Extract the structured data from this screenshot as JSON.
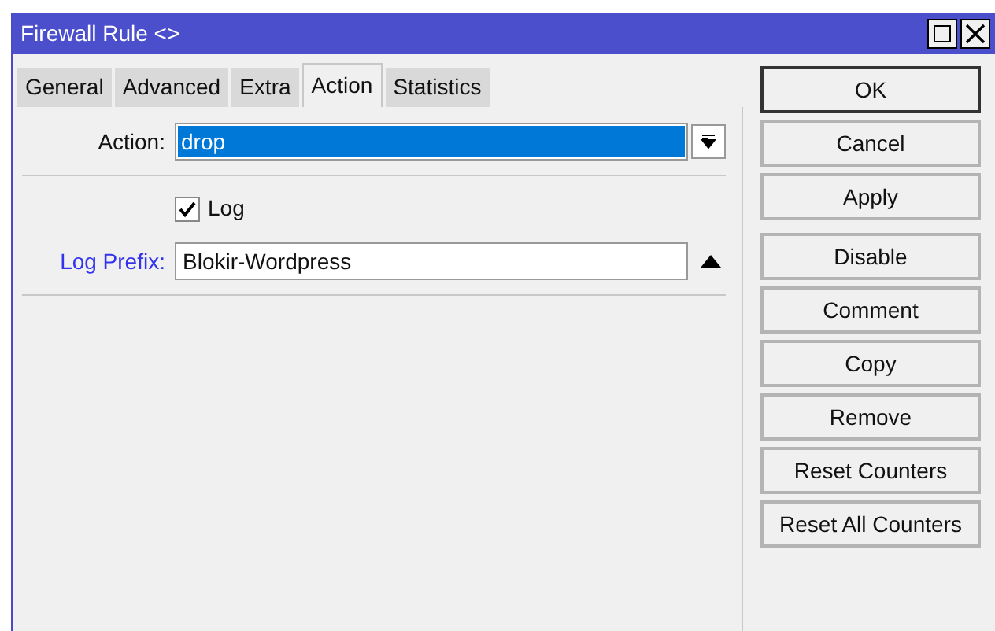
{
  "window": {
    "title": "Firewall Rule <>"
  },
  "tabs": [
    {
      "label": "General",
      "selected": false
    },
    {
      "label": "Advanced",
      "selected": false
    },
    {
      "label": "Extra",
      "selected": false
    },
    {
      "label": "Action",
      "selected": true
    },
    {
      "label": "Statistics",
      "selected": false
    }
  ],
  "action": {
    "label": "Action:",
    "value": "drop"
  },
  "log": {
    "label": "Log",
    "checked": true
  },
  "log_prefix": {
    "label": "Log Prefix:",
    "value": "Blokir-Wordpress"
  },
  "button_groups": [
    [
      {
        "label": "OK",
        "default": true
      },
      {
        "label": "Cancel",
        "default": false
      },
      {
        "label": "Apply",
        "default": false
      }
    ],
    [
      {
        "label": "Disable",
        "default": false
      },
      {
        "label": "Comment",
        "default": false
      },
      {
        "label": "Copy",
        "default": false
      },
      {
        "label": "Remove",
        "default": false
      },
      {
        "label": "Reset Counters",
        "default": false
      },
      {
        "label": "Reset All Counters",
        "default": false
      }
    ]
  ]
}
